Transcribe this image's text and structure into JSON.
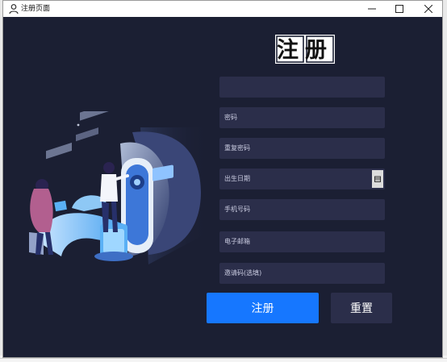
{
  "window": {
    "title": "注册页面",
    "controls": {
      "minimize": "minimize-icon",
      "maximize": "maximize-icon",
      "close": "close-icon"
    }
  },
  "header": {
    "logo_text": "注册"
  },
  "form": {
    "fields": [
      {
        "name": "username",
        "placeholder": ""
      },
      {
        "name": "password",
        "placeholder": "密码"
      },
      {
        "name": "confirm_password",
        "placeholder": "重复密码"
      },
      {
        "name": "birth_date",
        "placeholder": "出生日期"
      },
      {
        "name": "phone",
        "placeholder": "手机号码"
      },
      {
        "name": "email",
        "placeholder": "电子邮箱"
      },
      {
        "name": "invite_code",
        "placeholder": "邀请码(选填)"
      }
    ],
    "register_label": "注册",
    "reset_label": "重置"
  },
  "colors": {
    "background": "#1b1f33",
    "field": "#2b2e4a",
    "primary_button": "#1677ff",
    "secondary_button": "#2b2e4a"
  }
}
